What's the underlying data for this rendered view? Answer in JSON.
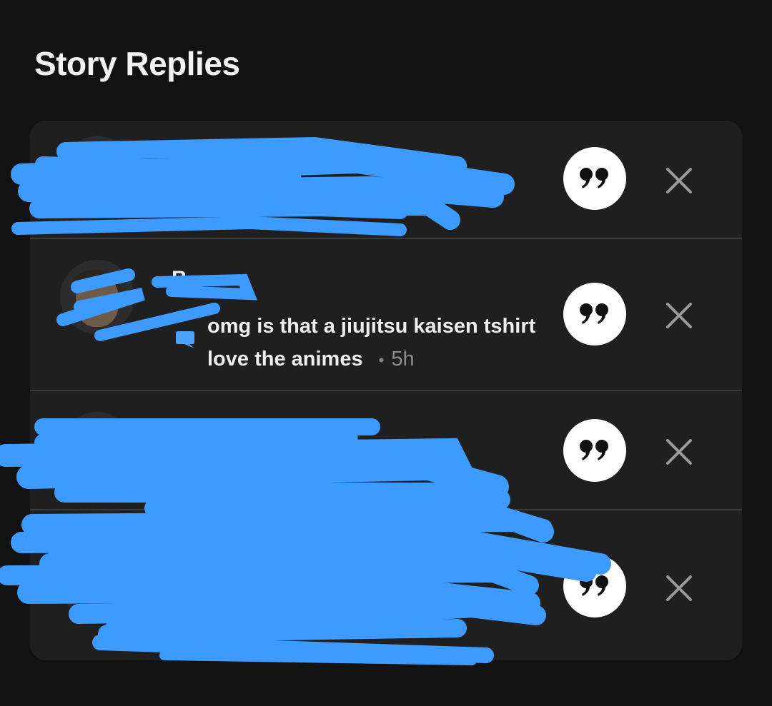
{
  "header": {
    "title": "Story Replies"
  },
  "replies": [
    {
      "username": "",
      "text": "",
      "time": "",
      "redacted": true
    },
    {
      "username": "B",
      "text": "omg is that a jiujitsu kaisen tshirt love the animes",
      "separator": "•",
      "time": "5h",
      "redacted": false
    },
    {
      "username": "",
      "text": "",
      "time": "",
      "redacted": true
    },
    {
      "username": "",
      "text": "",
      "time": "",
      "redacted": true
    }
  ],
  "icons": {
    "quote": "quote-reply-icon",
    "close": "close-icon",
    "reply": "chat-bubble-icon"
  },
  "colors": {
    "background": "#121212",
    "card": "#1f1f1f",
    "divider": "#3a3a3a",
    "redaction": "#3d9bff",
    "reply_icon": "#4aa3ff"
  }
}
